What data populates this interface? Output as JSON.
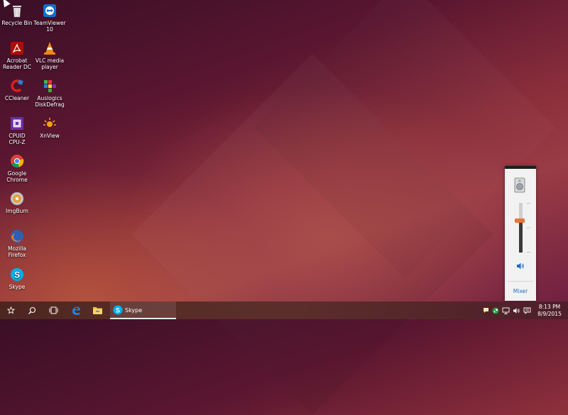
{
  "desktop": {
    "icons": [
      {
        "label1": "Recycle Bin",
        "label2": "",
        "icon": "recycle-bin-icon"
      },
      {
        "label1": "TeamViewer",
        "label2": "10",
        "icon": "teamviewer-icon"
      },
      {
        "label1": "Acrobat",
        "label2": "Reader DC",
        "icon": "acrobat-reader-icon"
      },
      {
        "label1": "VLC media",
        "label2": "player",
        "icon": "vlc-icon"
      },
      {
        "label1": "CCleaner",
        "label2": "",
        "icon": "ccleaner-icon"
      },
      {
        "label1": "Auslogics",
        "label2": "DiskDefrag",
        "icon": "auslogics-icon"
      },
      {
        "label1": "CPUID",
        "label2": "CPU-Z",
        "icon": "cpuz-icon"
      },
      {
        "label1": "XnView",
        "label2": "",
        "icon": "xnview-icon"
      },
      {
        "label1": "Google",
        "label2": "Chrome",
        "icon": "chrome-icon"
      },
      {
        "label1": "ImgBurn",
        "label2": "",
        "icon": "imgburn-icon"
      },
      {
        "label1": "Mozilla",
        "label2": "Firefox",
        "icon": "firefox-icon"
      },
      {
        "label1": "Skype",
        "label2": "",
        "icon": "skype-icon"
      }
    ]
  },
  "volume_flyout": {
    "level_percent": 65,
    "mixer_label": "Mixer",
    "device_icon": "speakers-device-icon",
    "speaker_icon": "speaker-icon"
  },
  "taskbar": {
    "start_icon": "start-icon",
    "search_icon": "search-icon",
    "task_view_icon": "task-view-icon",
    "edge_icon": "edge-icon",
    "explorer_icon": "file-explorer-icon",
    "active_app_label": "Skype",
    "tray_icons": [
      "chat-bubble-icon",
      "steam-icon",
      "network-icon",
      "volume-icon",
      "notification-icon"
    ],
    "clock_time": "8:13 PM",
    "clock_date": "8/9/2015"
  },
  "colors": {
    "accent_orange": "#e8743b",
    "link_blue": "#1e6fc3",
    "skype_blue": "#00aff0"
  }
}
